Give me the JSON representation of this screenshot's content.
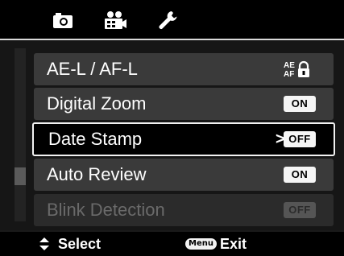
{
  "tabs": [
    {
      "icon": "camera-icon"
    },
    {
      "icon": "movie-camera-icon"
    },
    {
      "icon": "wrench-icon"
    }
  ],
  "menu": {
    "items": [
      {
        "label": "AE-L / AF-L",
        "value_icon": "ae-af-lock-icon",
        "state": "normal"
      },
      {
        "label": "Digital Zoom",
        "value": "ON",
        "state": "normal"
      },
      {
        "label": "Date Stamp",
        "value": "OFF",
        "arrow": ">",
        "state": "selected"
      },
      {
        "label": "Auto Review",
        "value": "ON",
        "state": "normal"
      },
      {
        "label": "Blink Detection",
        "value": "OFF",
        "state": "disabled"
      }
    ]
  },
  "aefa": {
    "top": "AE",
    "bottom": "AF"
  },
  "footer": {
    "select_label": "Select",
    "menu_key": "Menu",
    "exit_label": "Exit"
  },
  "colors": {
    "background": "#000000",
    "item_bg": "#3a3a3a",
    "selected_border": "#f2f2f2",
    "disabled_text": "#6a6a6a"
  }
}
